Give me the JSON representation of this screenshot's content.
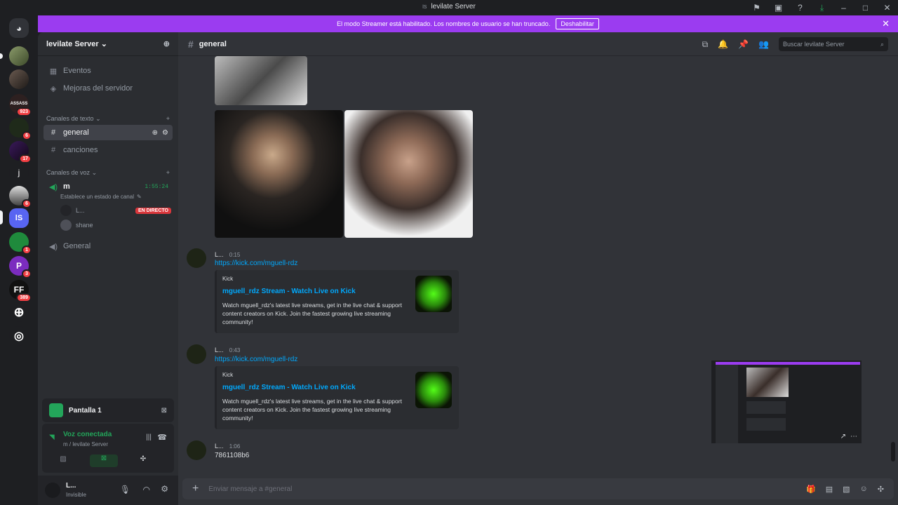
{
  "window": {
    "title": "levilate Server",
    "server_abbr": "lS"
  },
  "guilds": {
    "badges": [
      "923",
      "6",
      "17",
      "6",
      "1",
      "3",
      "389"
    ],
    "letter_j": "j",
    "ls_label": "lS",
    "ff_label": "FF"
  },
  "banner": {
    "text": "El modo Streamer está habilitado. Los nombres de usuario se han truncado.",
    "button": "Deshabilitar"
  },
  "server": {
    "name": "levilate Server",
    "items": [
      {
        "label": "Eventos",
        "icon": "calendar-icon"
      },
      {
        "label": "Mejoras del servidor",
        "icon": "boost-icon"
      }
    ],
    "text_category": "Canales de texto",
    "text_channels": [
      {
        "label": "general",
        "active": true
      },
      {
        "label": "canciones",
        "active": false
      }
    ],
    "voice_category": "Canales de voz",
    "voice_channel": {
      "label": "m",
      "timer": "1:55:24",
      "status": "Establece un estado de canal",
      "users": [
        {
          "name": "L...",
          "live": "EN DIRECTO"
        },
        {
          "name": "shane"
        }
      ]
    },
    "voice_channel_2": "General"
  },
  "stream_panel": {
    "title": "Pantalla 1"
  },
  "voice_panel": {
    "status": "Voz conectada",
    "location": "m / levilate Server"
  },
  "user_panel": {
    "name": "L...",
    "status": "Invisible"
  },
  "channel": {
    "name": "general",
    "search_placeholder": "Buscar levilate Server"
  },
  "messages": [
    {
      "author": "L...",
      "time": "0:15",
      "link": "https://kick.com/mguell-rdz",
      "embed": {
        "provider": "Kick",
        "title": "mguell_rdz Stream - Watch Live on Kick",
        "description": "Watch mguell_rdz's latest live streams, get in the live chat & support content creators on Kick. Join the fastest growing live streaming community!"
      }
    },
    {
      "author": "L...",
      "time": "0:43",
      "link": "https://kick.com/mguell-rdz",
      "embed": {
        "provider": "Kick",
        "title": "mguell_rdz Stream - Watch Live on Kick",
        "description": "Watch mguell_rdz's latest live streams, get in the live chat & support content creators on Kick. Join the fastest growing live streaming community!"
      }
    },
    {
      "author": "L...",
      "time": "1:06",
      "text": "7861108b6"
    }
  ],
  "composer": {
    "placeholder": "Enviar mensaje a #general"
  }
}
